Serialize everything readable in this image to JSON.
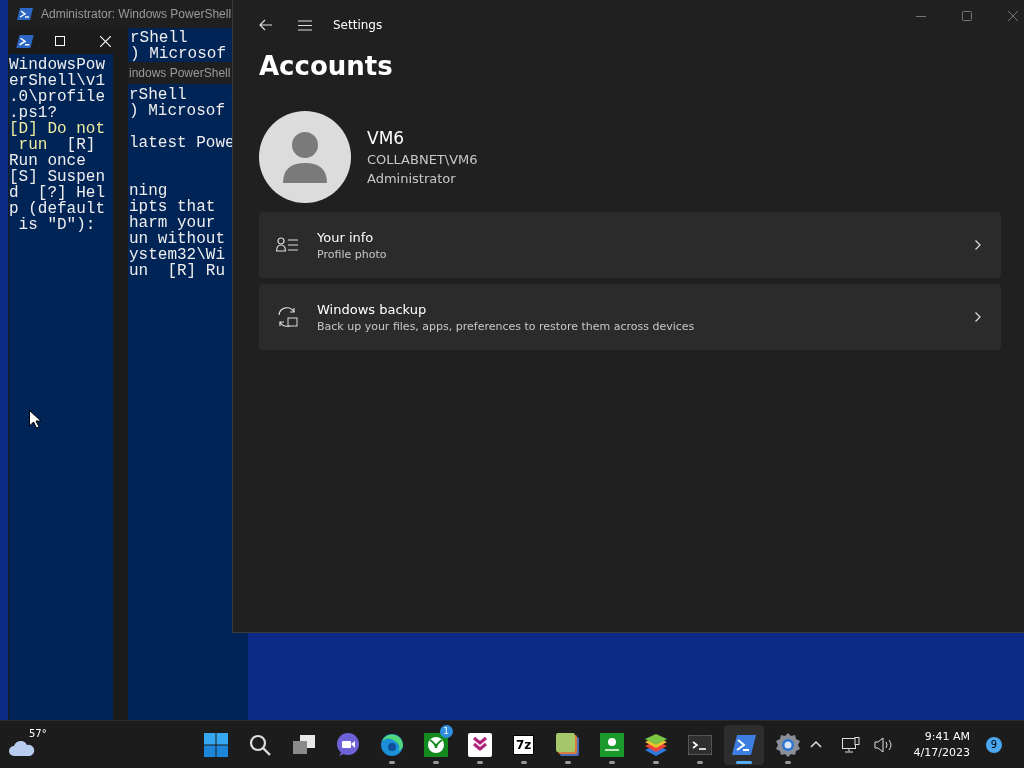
{
  "back_window": {
    "title": "Administrator: Windows PowerShell",
    "lines": [
      "rShell",
      ") Microsof"
    ]
  },
  "middle_window": {
    "title": "indows PowerShell",
    "blocks": [
      [
        "rShell",
        ") Microsof"
      ],
      [
        "latest Powe"
      ],
      [
        "ning",
        "ipts that",
        "harm your",
        "un without",
        "ystem32\\Wi",
        "un  [R] Ru"
      ]
    ]
  },
  "front_window": {
    "lines": [
      [
        {
          "text": "WindowsPow",
          "kind": "normal"
        }
      ],
      [
        {
          "text": "erShell\\v1",
          "kind": "normal"
        }
      ],
      [
        {
          "text": ".0\\profile",
          "kind": "normal"
        }
      ],
      [
        {
          "text": ".ps1?",
          "kind": "normal"
        }
      ],
      [
        {
          "text": "[D] Do not",
          "kind": "default_choice"
        }
      ],
      [
        {
          "text": " run",
          "kind": "default_choice"
        },
        {
          "text": "  [R]",
          "kind": "normal"
        }
      ],
      [
        {
          "text": "Run once",
          "kind": "normal"
        }
      ],
      [
        {
          "text": "[S] Suspen",
          "kind": "normal"
        }
      ],
      [
        {
          "text": "d  [?] Hel",
          "kind": "normal"
        }
      ],
      [
        {
          "text": "p (default",
          "kind": "normal"
        }
      ],
      [
        {
          "text": " is \"D\"):",
          "kind": "normal"
        }
      ]
    ]
  },
  "settings": {
    "title": "Settings",
    "heading": "Accounts",
    "user": {
      "name": "VM6",
      "account": "COLLABNET\\VM6",
      "role": "Administrator"
    },
    "items": [
      {
        "kind": "info",
        "title": "Your info",
        "subtitle": "Profile photo"
      },
      {
        "kind": "backup",
        "title": "Windows backup",
        "subtitle": "Back up your files, apps, preferences to restore them across devices"
      }
    ]
  },
  "taskbar": {
    "weather": {
      "temperature": "57°"
    },
    "apps": [
      {
        "kind": "start",
        "running": false,
        "selected": false
      },
      {
        "kind": "search",
        "running": false,
        "selected": false
      },
      {
        "kind": "task_view",
        "running": false,
        "selected": false
      },
      {
        "kind": "meet",
        "running": false,
        "selected": false
      },
      {
        "kind": "edge",
        "running": true,
        "selected": false
      },
      {
        "kind": "xbox",
        "running": true,
        "selected": false,
        "badge": "1"
      },
      {
        "kind": "pocket",
        "running": true,
        "selected": false
      },
      {
        "kind": "sevenzip",
        "running": true,
        "selected": false,
        "label": "7z"
      },
      {
        "kind": "notes",
        "running": true,
        "selected": false
      },
      {
        "kind": "xbox_app",
        "running": true,
        "selected": false
      },
      {
        "kind": "bluestacks",
        "running": true,
        "selected": false
      },
      {
        "kind": "terminal",
        "running": true,
        "selected": false
      },
      {
        "kind": "powershell",
        "running": true,
        "selected": true
      },
      {
        "kind": "settings",
        "running": true,
        "selected": false
      }
    ],
    "time": "9:41 AM",
    "date": "4/17/2023",
    "notifications": "9"
  }
}
